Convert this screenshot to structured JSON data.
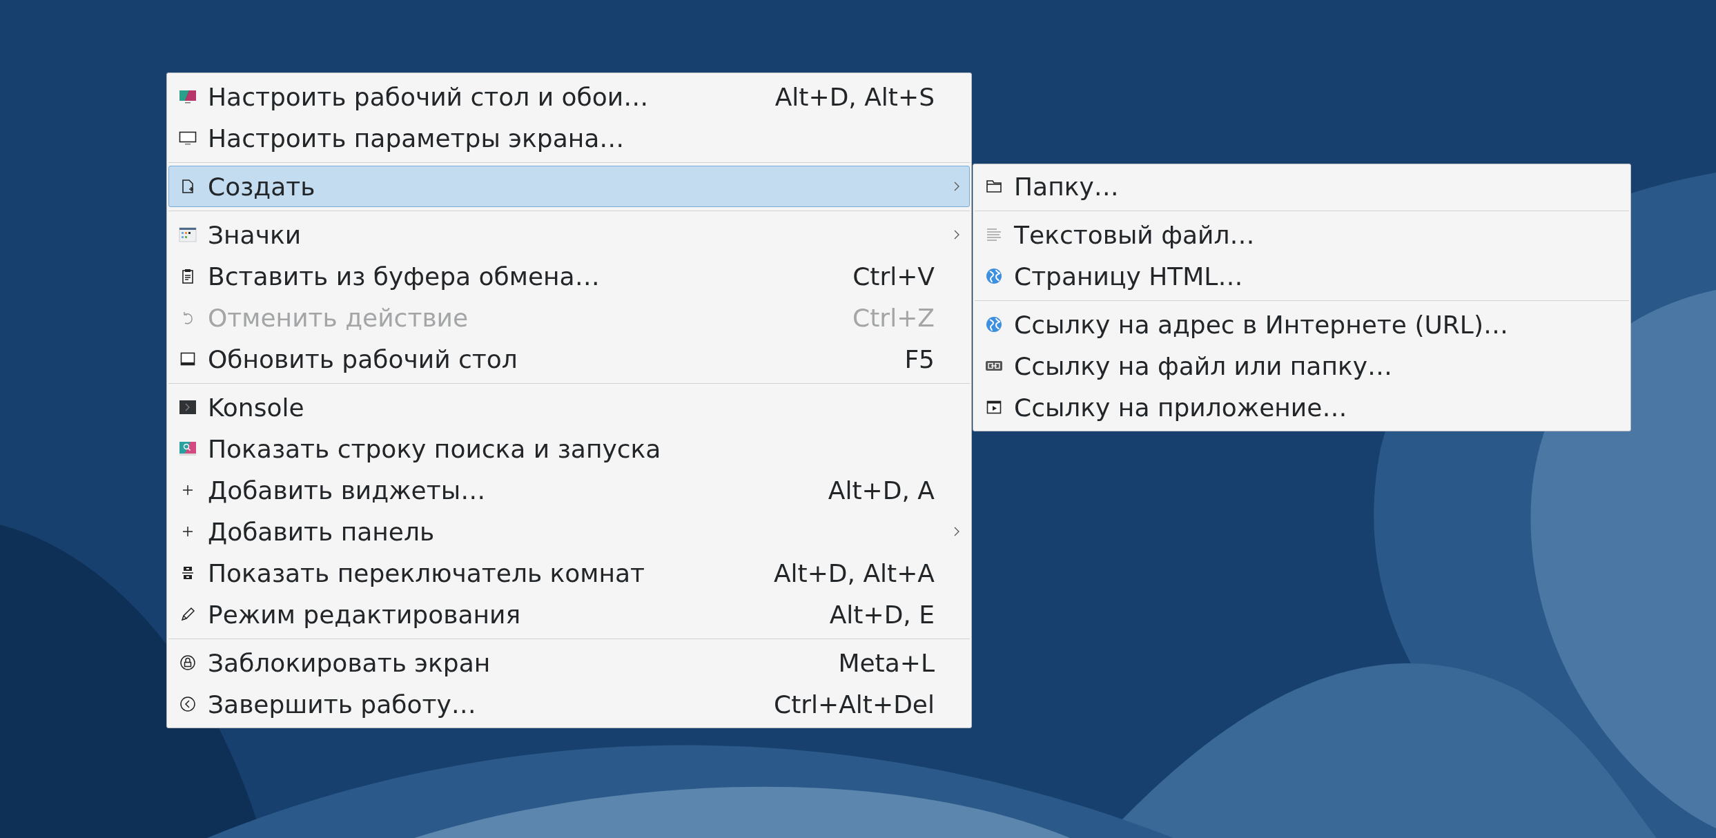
{
  "menu": {
    "items": [
      {
        "kind": "item",
        "label": "Настроить рабочий стол и обои…",
        "shortcut": "Alt+D, Alt+S",
        "has_submenu": false,
        "selected": false,
        "disabled": false
      },
      {
        "kind": "item",
        "label": "Настроить параметры экрана…",
        "has_submenu": false,
        "selected": false,
        "disabled": false
      },
      {
        "kind": "separator"
      },
      {
        "kind": "item",
        "label": "Создать",
        "has_submenu": true,
        "selected": true,
        "disabled": false,
        "children": [
          {
            "kind": "item",
            "label": "Папку…",
            "selected": false,
            "disabled": false
          },
          {
            "kind": "separator"
          },
          {
            "kind": "item",
            "label": "Текстовый файл…",
            "selected": false,
            "disabled": false
          },
          {
            "kind": "item",
            "label": "Страницу HTML…",
            "selected": false,
            "disabled": false
          },
          {
            "kind": "separator"
          },
          {
            "kind": "item",
            "label": "Ссылку на адрес в Интернете (URL)…",
            "selected": false,
            "disabled": false
          },
          {
            "kind": "item",
            "label": "Ссылку на файл или папку…",
            "selected": false,
            "disabled": false
          },
          {
            "kind": "item",
            "label": "Ссылку на приложение…",
            "selected": false,
            "disabled": false
          }
        ]
      },
      {
        "kind": "separator"
      },
      {
        "kind": "item",
        "label": "Значки",
        "has_submenu": true,
        "selected": false,
        "disabled": false
      },
      {
        "kind": "item",
        "label": "Вставить из буфера обмена…",
        "shortcut": "Ctrl+V",
        "has_submenu": false,
        "selected": false,
        "disabled": false
      },
      {
        "kind": "item",
        "label": "Отменить действие",
        "shortcut": "Ctrl+Z",
        "has_submenu": false,
        "selected": false,
        "disabled": true
      },
      {
        "kind": "item",
        "label": "Обновить рабочий стол",
        "shortcut": "F5",
        "has_submenu": false,
        "selected": false,
        "disabled": false
      },
      {
        "kind": "separator"
      },
      {
        "kind": "item",
        "label": "Konsole",
        "has_submenu": false,
        "selected": false,
        "disabled": false
      },
      {
        "kind": "item",
        "label": "Показать строку поиска и запуска",
        "has_submenu": false,
        "selected": false,
        "disabled": false
      },
      {
        "kind": "item",
        "label": "Добавить виджеты…",
        "shortcut": "Alt+D, A",
        "has_submenu": false,
        "selected": false,
        "disabled": false
      },
      {
        "kind": "item",
        "label": "Добавить панель",
        "has_submenu": true,
        "selected": false,
        "disabled": false
      },
      {
        "kind": "item",
        "label": "Показать переключатель комнат",
        "shortcut": "Alt+D, Alt+A",
        "has_submenu": false,
        "selected": false,
        "disabled": false
      },
      {
        "kind": "item",
        "label": "Режим редактирования",
        "shortcut": "Alt+D, E",
        "has_submenu": false,
        "selected": false,
        "disabled": false
      },
      {
        "kind": "separator"
      },
      {
        "kind": "item",
        "label": "Заблокировать экран",
        "shortcut": "Meta+L",
        "has_submenu": false,
        "selected": false,
        "disabled": false
      },
      {
        "kind": "item",
        "label": "Завершить работу…",
        "shortcut": "Ctrl+Alt+Del",
        "has_submenu": false,
        "selected": false,
        "disabled": false
      }
    ]
  }
}
